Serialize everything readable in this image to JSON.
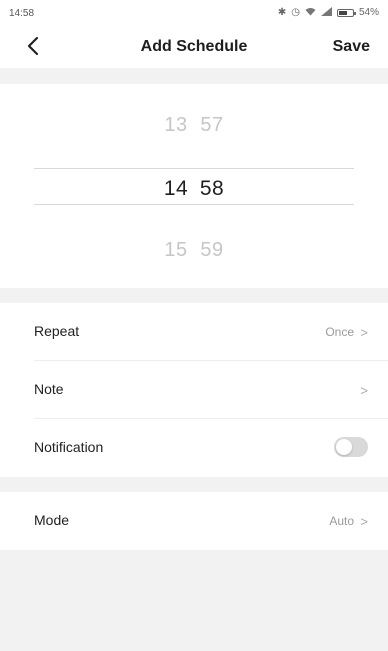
{
  "status_bar": {
    "time": "14:58",
    "bluetooth_icon": "bluetooth-icon",
    "alarm_icon": "alarm-icon",
    "wifi_icon": "wifi-icon",
    "signal_icon": "signal-icon",
    "battery_percent": "54%",
    "battery_level": 0.54
  },
  "nav": {
    "back_icon": "chevron-left-icon",
    "title": "Add Schedule",
    "save_label": "Save"
  },
  "picker": {
    "prev": {
      "hour": "13",
      "minute": "57"
    },
    "current": {
      "hour": "14",
      "minute": "58"
    },
    "next": {
      "hour": "15",
      "minute": "59"
    }
  },
  "settings": {
    "repeat": {
      "label": "Repeat",
      "value": "Once"
    },
    "note": {
      "label": "Note",
      "value": ""
    },
    "notification": {
      "label": "Notification",
      "enabled": false
    },
    "mode": {
      "label": "Mode",
      "value": "Auto"
    }
  },
  "colors": {
    "background": "#f2f2f2",
    "card": "#ffffff",
    "toggle_off": "#d9d9d9",
    "muted_text": "#9a9a9a"
  }
}
